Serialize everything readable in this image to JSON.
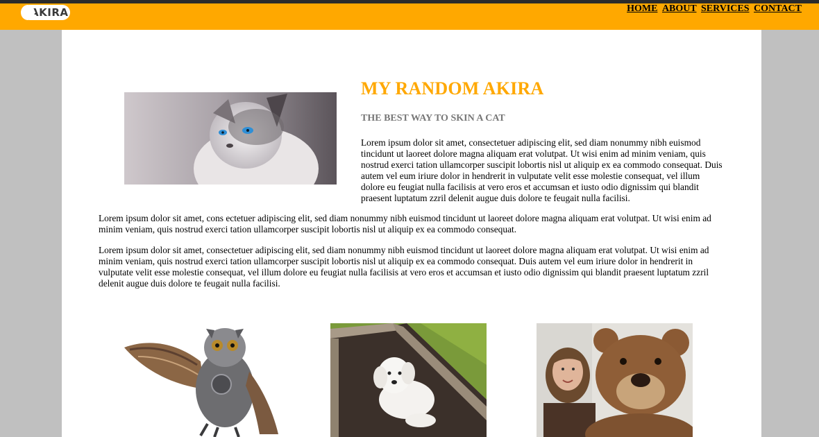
{
  "logo": {
    "text": "AKIRA"
  },
  "nav": {
    "items": [
      {
        "label": "HOME"
      },
      {
        "label": "ABOUT"
      },
      {
        "label": "SERVICES"
      },
      {
        "label": "CONTACT"
      }
    ]
  },
  "hero": {
    "title": "MY RANDOM AKIRA",
    "subtitle": "THE BEST WAY TO SKIN A CAT",
    "intro": "Lorem ipsum dolor sit amet, consectetuer adipiscing elit, sed diam nonummy nibh euismod tincidunt ut laoreet dolore magna aliquam erat volutpat. Ut wisi enim ad minim veniam, quis nostrud exerci tation ullamcorper suscipit lobortis nisl ut aliquip ex ea commodo consequat. Duis autem vel eum iriure dolor in hendrerit in vulputate velit esse molestie consequat, vel illum dolore eu feugiat nulla facilisis at vero eros et accumsan et iusto odio dignissim qui blandit praesent luptatum zzril delenit augue duis dolore te feugait nulla facilisi."
  },
  "body": {
    "paragraph1": "Lorem ipsum dolor sit amet, cons ectetuer adipiscing elit, sed diam nonummy nibh euismod tincidunt ut laoreet dolore magna aliquam erat volutpat. Ut wisi enim ad minim veniam, quis nostrud exerci tation ullamcorper suscipit lobortis nisl ut aliquip ex ea commodo consequat.",
    "paragraph2": "Lorem ipsum dolor sit amet, consectetuer adipiscing elit, sed diam nonummy nibh euismod tincidunt ut laoreet dolore magna aliquam erat volutpat. Ut wisi enim ad minim veniam, quis nostrud exerci tation ullamcorper suscipit lobortis nisl ut aliquip ex ea commodo consequat. Duis autem vel eum iriure dolor in hendrerit in vulputate velit esse molestie consequat, vel illum dolore eu feugiat nulla facilisis at vero eros et accumsan et iusto odio dignissim qui blandit praesent luptatum zzril delenit augue duis dolore te feugait nulla facilisi."
  },
  "colors": {
    "accent": "#ffa800",
    "subtitle": "#777777",
    "background": "#c0c0c0"
  }
}
